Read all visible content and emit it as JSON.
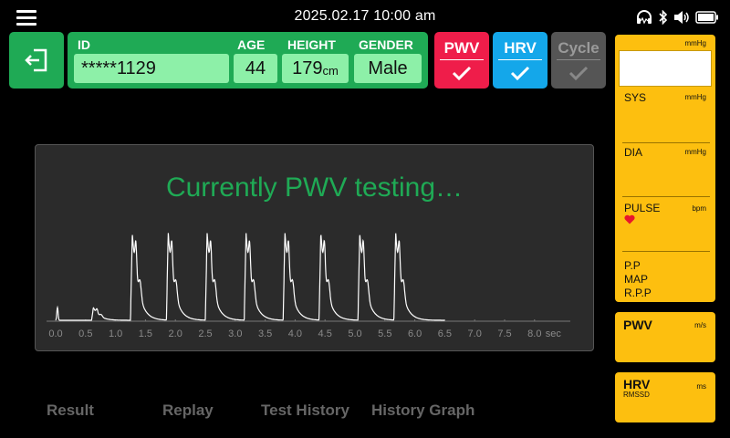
{
  "header": {
    "datetime": "2025.02.17  10:00 am"
  },
  "patient": {
    "id_label": "ID",
    "id_value": "*****1129",
    "age_label": "AGE",
    "age_value": "44",
    "height_label": "HEIGHT",
    "height_value": "179",
    "height_unit": "cm",
    "gender_label": "GENDER",
    "gender_value": "Male"
  },
  "modes": [
    {
      "label": "PWV",
      "color": "#ef1d4a",
      "enabled": true
    },
    {
      "label": "HRV",
      "color": "#14a7ea",
      "enabled": true
    },
    {
      "label": "Cycle",
      "color": "#555555",
      "enabled": false
    }
  ],
  "chart": {
    "message": "Currently PWV testing…",
    "x_ticks": [
      "0.0",
      "0.5",
      "1.0",
      "1.5",
      "2.0",
      "2.5",
      "3.0",
      "3.5",
      "4.0",
      "4.5",
      "5.0",
      "5.5",
      "6.0",
      "6.5",
      "7.0",
      "7.5",
      "8.0"
    ],
    "x_unit": "sec",
    "pulse_times": [
      0.65,
      1.3,
      1.9,
      2.55,
      3.2,
      3.85,
      4.45,
      5.1,
      5.7
    ],
    "trace_end": 6.5
  },
  "tabs": {
    "result": "Result",
    "replay": "Replay",
    "test_history": "Test History",
    "history_graph": "History Graph"
  },
  "bp_panel": {
    "unit_top": "mmHg",
    "sys_label": "SYS",
    "sys_unit": "mmHg",
    "dia_label": "DIA",
    "dia_unit": "mmHg",
    "pulse_label": "PULSE",
    "pulse_unit": "bpm",
    "pp_label": "P.P",
    "map_label": "MAP",
    "rpp_label": "R.P.P"
  },
  "pwv_panel": {
    "label": "PWV",
    "unit": "m/s"
  },
  "hrv_panel": {
    "label": "HRV",
    "sublabel": "RMSSD",
    "unit": "ms"
  },
  "colors": {
    "green": "#1faa55",
    "yellow": "#fdbf0f"
  }
}
